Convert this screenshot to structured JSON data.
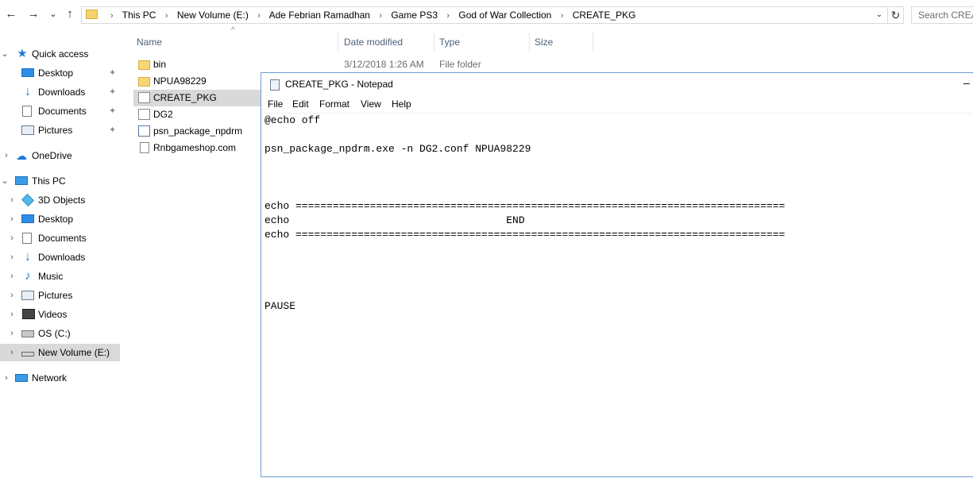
{
  "address_bar": {
    "crumbs": [
      "This PC",
      "New Volume (E:)",
      "Ade Febrian Ramadhan",
      "Game PS3",
      "God of War Collection",
      "CREATE_PKG"
    ],
    "separator": "›",
    "search_placeholder": "Search CREATE_PKG"
  },
  "nav": {
    "back": "←",
    "forward": "→",
    "recent": "⌄",
    "up": "↑",
    "refresh": "↻",
    "dropdown": "⌄",
    "expand": "›",
    "collapse": "⌄",
    "pin": "📌"
  },
  "sidebar": {
    "quick_access": "Quick access",
    "qa_items": [
      "Desktop",
      "Downloads",
      "Documents",
      "Pictures"
    ],
    "onedrive": "OneDrive",
    "this_pc": "This PC",
    "pc_items": [
      "3D Objects",
      "Desktop",
      "Documents",
      "Downloads",
      "Music",
      "Pictures",
      "Videos",
      "OS (C:)",
      "New Volume (E:)"
    ],
    "network": "Network"
  },
  "files": {
    "columns": [
      "Name",
      "Date modified",
      "Type",
      "Size"
    ],
    "sort_indicator": "^",
    "rows": [
      {
        "name": "bin",
        "date": "3/12/2018 1:26 AM",
        "type": "File folder"
      },
      {
        "name": "NPUA98229"
      },
      {
        "name": "CREATE_PKG"
      },
      {
        "name": "DG2"
      },
      {
        "name": "psn_package_npdrm"
      },
      {
        "name": "Rnbgameshop.com"
      }
    ]
  },
  "notepad": {
    "title": "CREATE_PKG - Notepad",
    "minimize": "–",
    "menu": [
      "File",
      "Edit",
      "Format",
      "View",
      "Help"
    ],
    "lines": [
      "@echo off",
      "",
      "psn_package_npdrm.exe -n DG2.conf NPUA98229",
      "",
      "",
      "",
      "echo ===============================================================================",
      "echo                                   END",
      "echo ===============================================================================",
      "",
      "",
      "",
      "",
      "PAUSE"
    ]
  }
}
